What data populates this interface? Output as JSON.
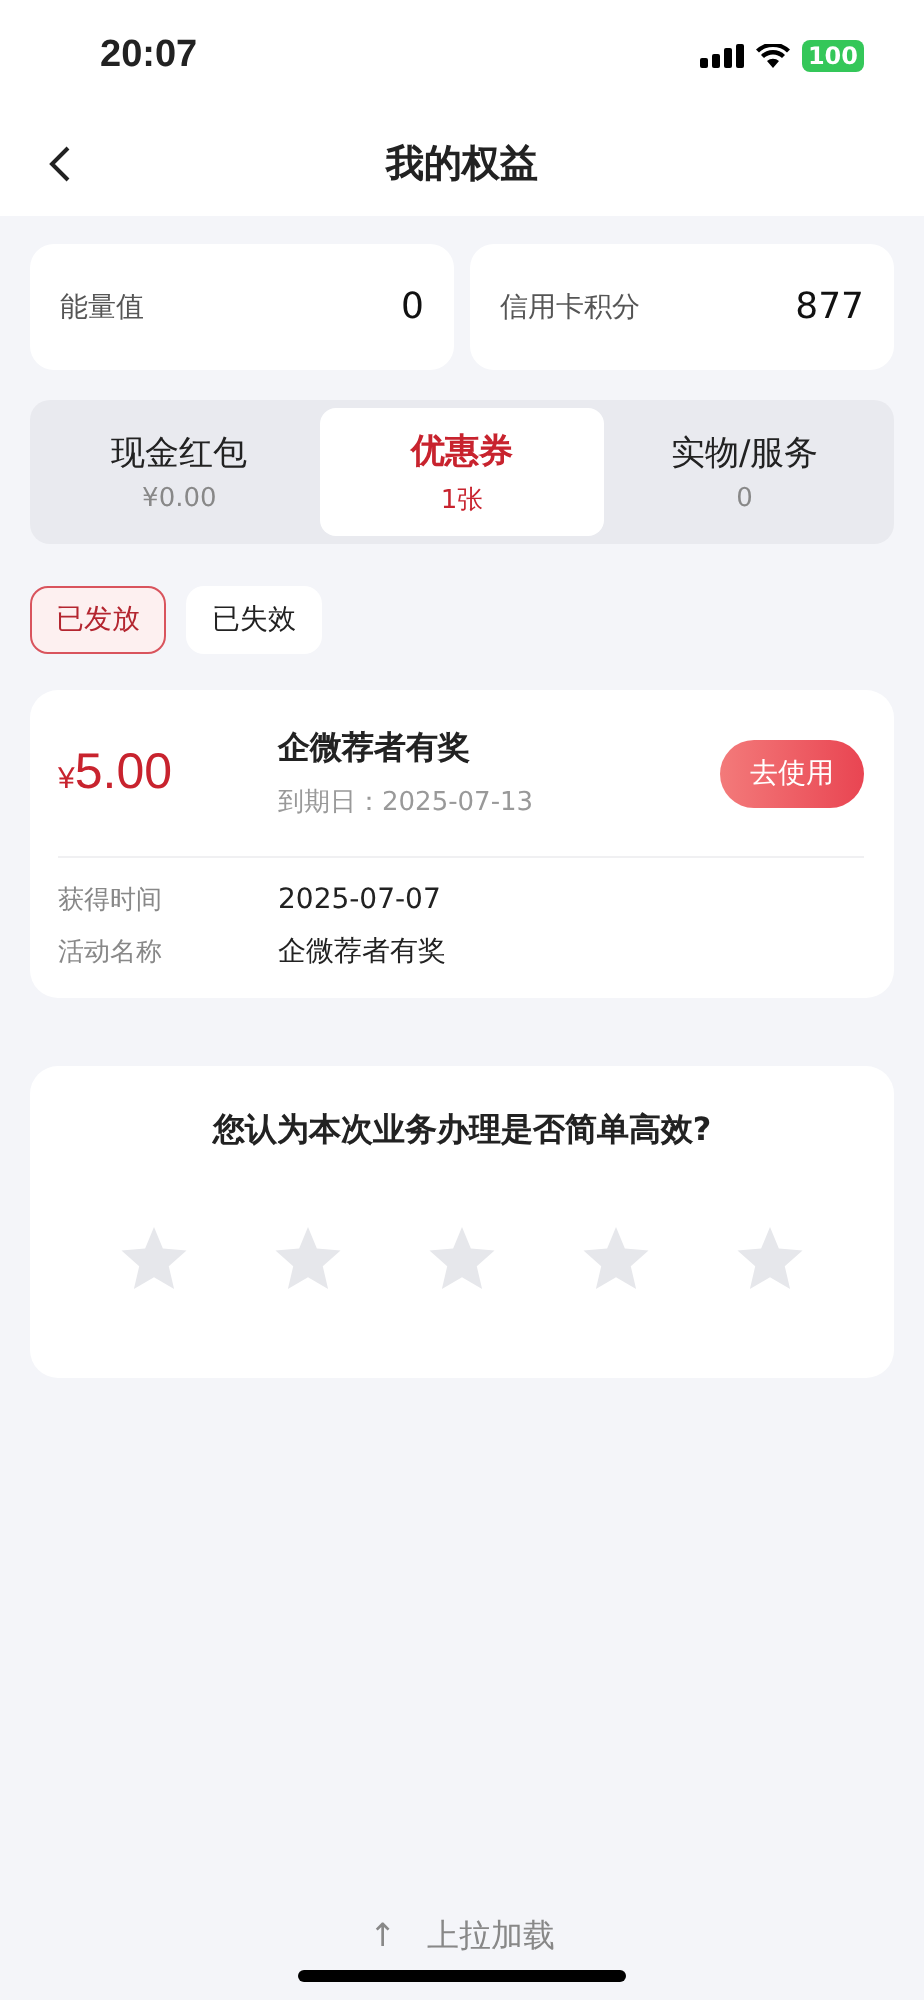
{
  "status_bar": {
    "time": "20:07",
    "battery": "100"
  },
  "header": {
    "title": "我的权益"
  },
  "summary": [
    {
      "label": "能量值",
      "value": "0"
    },
    {
      "label": "信用卡积分",
      "value": "877"
    }
  ],
  "tabs": [
    {
      "label": "现金红包",
      "count": "¥0.00",
      "selected": false
    },
    {
      "label": "优惠券",
      "count": "1张",
      "selected": true
    },
    {
      "label": "实物/服务",
      "count": "0",
      "selected": false
    }
  ],
  "filters": [
    {
      "label": "已发放",
      "selected": true
    },
    {
      "label": "已失效",
      "selected": false
    }
  ],
  "coupons": [
    {
      "amount": "5.00",
      "currency": "¥",
      "title": "企微荐者有奖",
      "expiry": "到期日：2025-07-13",
      "button": "去使用",
      "details": [
        {
          "label": "获得时间",
          "value": "2025-07-07"
        },
        {
          "label": "活动名称",
          "value": "企微荐者有奖"
        }
      ]
    }
  ],
  "survey": {
    "question": "您认为本次业务办理是否简单高效?",
    "stars": 0
  },
  "footer": {
    "arrow": "↑",
    "text": "上拉加载"
  }
}
